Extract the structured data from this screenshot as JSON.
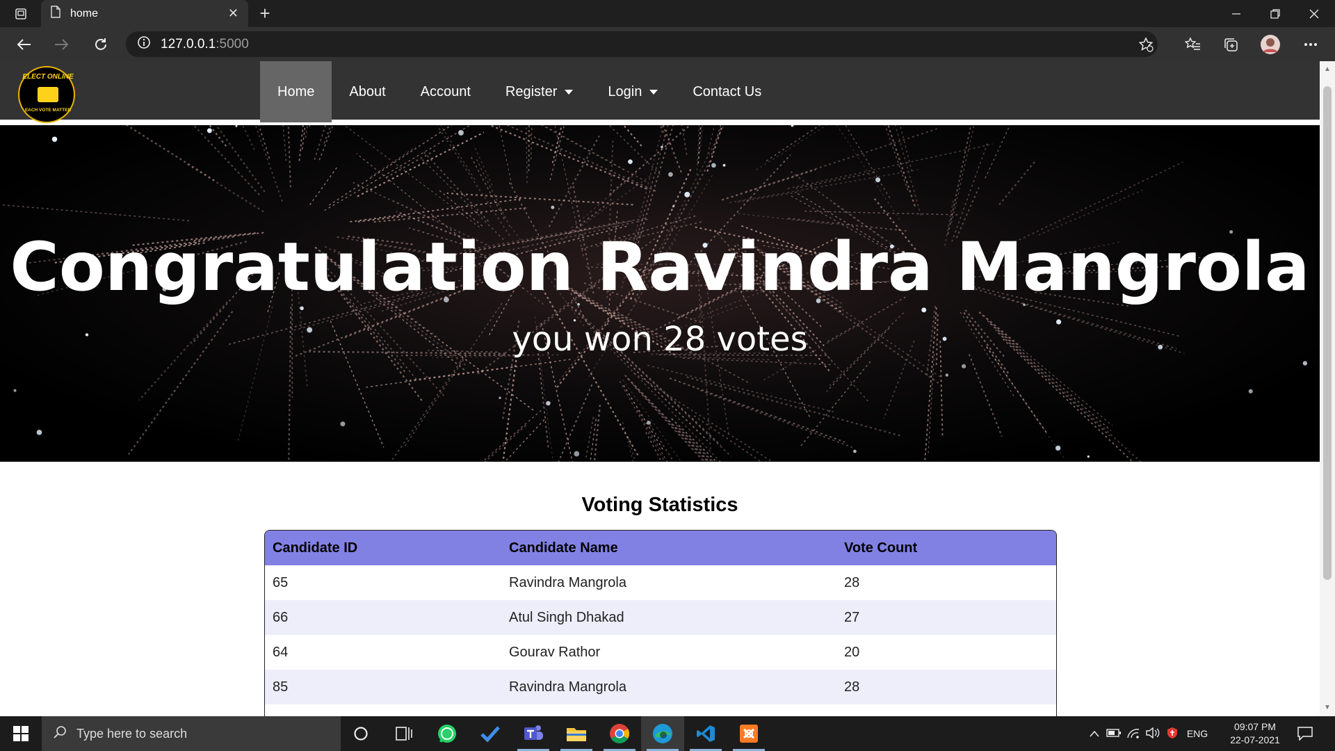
{
  "browser": {
    "tab_title": "home",
    "url_host": "127.0.0.1",
    "url_port": ":5000"
  },
  "site": {
    "logo": {
      "top_text": "ELECT ONLINE",
      "bottom_text": "EACH VOTE MATTER"
    },
    "menu": [
      {
        "label": "Home",
        "active": true
      },
      {
        "label": "About"
      },
      {
        "label": "Account"
      },
      {
        "label": "Register",
        "dropdown": true
      },
      {
        "label": "Login",
        "dropdown": true
      },
      {
        "label": "Contact Us"
      }
    ]
  },
  "hero": {
    "title": "Congratulation Ravindra Mangrola",
    "subtitle": "you won 28 votes"
  },
  "stats": {
    "title": "Voting Statistics",
    "columns": [
      "Candidate ID",
      "Candidate Name",
      "Vote Count"
    ],
    "rows": [
      [
        "65",
        "Ravindra Mangrola",
        "28"
      ],
      [
        "66",
        "Atul Singh Dhakad",
        "27"
      ],
      [
        "64",
        "Gourav Rathor",
        "20"
      ],
      [
        "85",
        "Ravindra Mangrola",
        "28"
      ],
      [
        "",
        "",
        ""
      ]
    ]
  },
  "taskbar": {
    "search_placeholder": "Type here to search",
    "language": "ENG",
    "time": "09:07 PM",
    "date": "22-07-2021",
    "apps": [
      "cortana-icon",
      "task-view-icon",
      "whatsapp-icon",
      "todo-icon",
      "teams-icon",
      "file-explorer-icon",
      "chrome-icon",
      "edge-icon",
      "vscode-icon",
      "xampp-icon"
    ]
  },
  "colors": {
    "table_header": "#8181e4",
    "table_alt_row": "#eeeefb",
    "site_nav": "#333333",
    "active_menu": "#666666"
  }
}
